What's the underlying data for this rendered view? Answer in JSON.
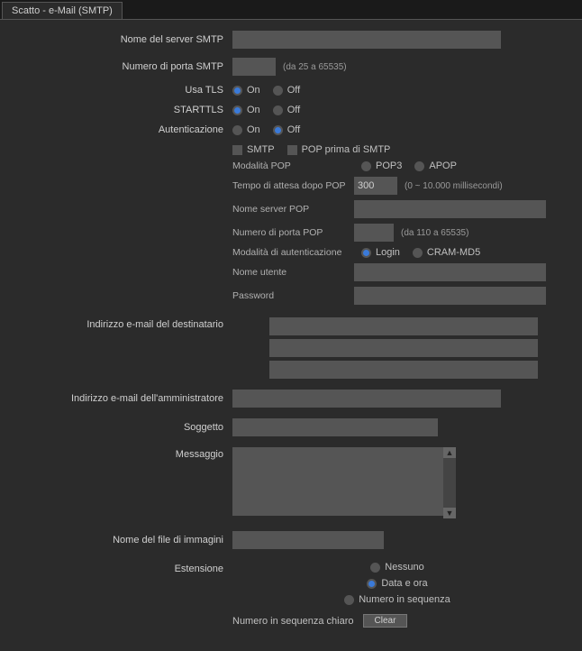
{
  "tab": {
    "label": "Scatto - e-Mail (SMTP)"
  },
  "labels": {
    "smtp_server": "Nome del server SMTP",
    "smtp_port": "Numero di porta SMTP",
    "use_tls": "Usa TLS",
    "starttls": "STARTTLS",
    "auth": "Autenticazione",
    "recipient": "Indirizzo e-mail del destinatario",
    "admin": "Indirizzo e-mail dell'amministratore",
    "subject": "Soggetto",
    "message": "Messaggio",
    "imagefile": "Nome del file di immagini",
    "ext": "Estensione"
  },
  "hints": {
    "smtp_port": "(da 25 a 65535)",
    "pop_wait": "(0 ~ 10.000 millisecondi)",
    "pop_port": "(da 110 a 65535)"
  },
  "radio": {
    "on": "On",
    "off": "Off",
    "pop3": "POP3",
    "apop": "APOP",
    "login": "Login",
    "crammd5": "CRAM-MD5",
    "none": "Nessuno",
    "datetime": "Data e ora",
    "seq": "Numero in sequenza"
  },
  "check": {
    "smtp": "SMTP",
    "popbefore": "POP prima di SMTP"
  },
  "sub": {
    "pop_mode": "Modalità POP",
    "pop_wait": "Tempo di attesa dopo POP",
    "pop_server": "Nome server POP",
    "pop_port": "Numero di porta POP",
    "auth_mode": "Modalità di autenticazione",
    "username": "Nome utente",
    "password": "Password",
    "seq_clear": "Numero in sequenza chiaro"
  },
  "values": {
    "smtp_server": "",
    "smtp_port": "",
    "pop_wait": "300",
    "pop_server": "",
    "pop_port": "",
    "username": "",
    "password": "",
    "recipient1": "",
    "recipient2": "",
    "recipient3": "",
    "admin": "",
    "subject": "",
    "message": "",
    "imagefile": ""
  },
  "buttons": {
    "clear": "Clear"
  }
}
